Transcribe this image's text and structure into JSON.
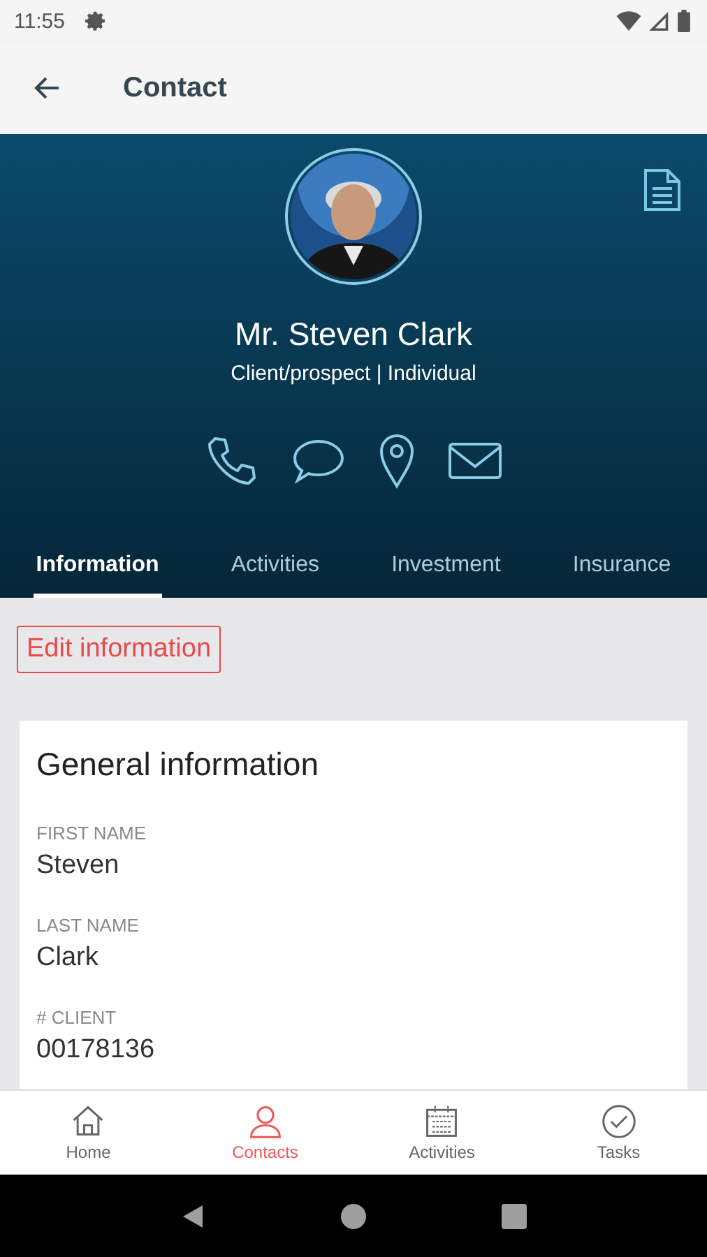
{
  "status_bar": {
    "time": "11:55"
  },
  "app_bar": {
    "title": "Contact"
  },
  "profile": {
    "name": "Mr. Steven Clark",
    "subtitle": "Client/prospect | Individual"
  },
  "tabs": [
    {
      "label": "Information",
      "selected": true
    },
    {
      "label": "Activities",
      "selected": false
    },
    {
      "label": "Investment",
      "selected": false
    },
    {
      "label": "Insurance",
      "selected": false
    }
  ],
  "edit_button": "Edit information",
  "card": {
    "title": "General information",
    "fields": [
      {
        "label": "FIRST NAME",
        "value": "Steven"
      },
      {
        "label": "LAST NAME",
        "value": "Clark"
      },
      {
        "label": "# CLIENT",
        "value": "00178136"
      }
    ]
  },
  "bottom_nav": [
    {
      "label": "Home",
      "selected": false
    },
    {
      "label": "Contacts",
      "selected": true
    },
    {
      "label": "Activities",
      "selected": false
    },
    {
      "label": "Tasks",
      "selected": false
    }
  ]
}
